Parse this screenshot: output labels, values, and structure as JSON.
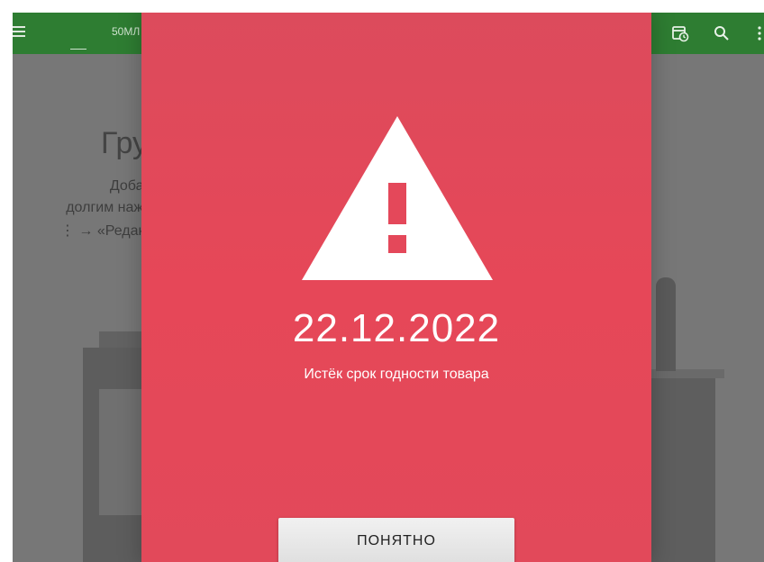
{
  "app_bar": {
    "title": "50МЛ",
    "color": "#2e7d32",
    "icons": [
      "menu-icon",
      "calendar-history-icon",
      "search-icon",
      "more-vert-icon"
    ]
  },
  "background": {
    "title_fragment": "Гру",
    "lines": [
      "Добав",
      "долгим нажа",
      "⋮ → «Редакт"
    ]
  },
  "dialog": {
    "color": "#e64758",
    "icon": "warning-triangle-icon",
    "date": "22.12.2022",
    "message": "Истёк срок годности товара",
    "button_label": "ПОНЯТНО"
  }
}
